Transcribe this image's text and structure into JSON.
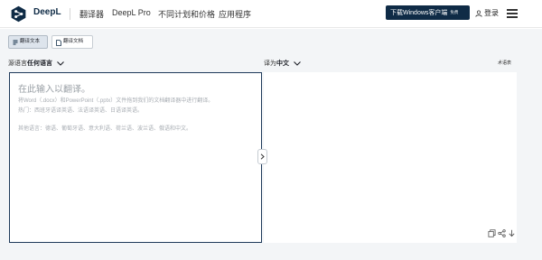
{
  "header": {
    "brand": "DeepL",
    "nav": [
      "翻译器",
      "DeepL Pro",
      "不同计划和价格",
      "应用程序"
    ],
    "download_button": "下载Windows客户端",
    "download_badge": "免费",
    "login": "登录",
    "icons": [
      "deepl-logo-icon",
      "user-icon",
      "menu-icon"
    ]
  },
  "tabs": [
    {
      "label": "翻译文本",
      "icon": "text-icon",
      "active": true
    },
    {
      "label": "翻译文档",
      "icon": "document-icon",
      "active": false
    }
  ],
  "source": {
    "prefix": "源语言",
    "language": "任何语言",
    "placeholder": "在此输入以翻译。",
    "hint_docs": "将Word（.docx）和PowerPoint（.pptx）文件拖到我们的文档翻译器中进行翻译。",
    "popular": "热门：西班牙语译英语、法语译英语、日语译英语。",
    "other": "其他语言：德语、葡萄牙语、意大利语、荷兰语、波兰语、俄语和中文。"
  },
  "target": {
    "prefix": "译为",
    "language": "中文",
    "glossary": "术语表"
  },
  "colors": {
    "navy": "#0f2b46",
    "background": "#f3f5f7",
    "border_active": "#1f3a5a"
  }
}
